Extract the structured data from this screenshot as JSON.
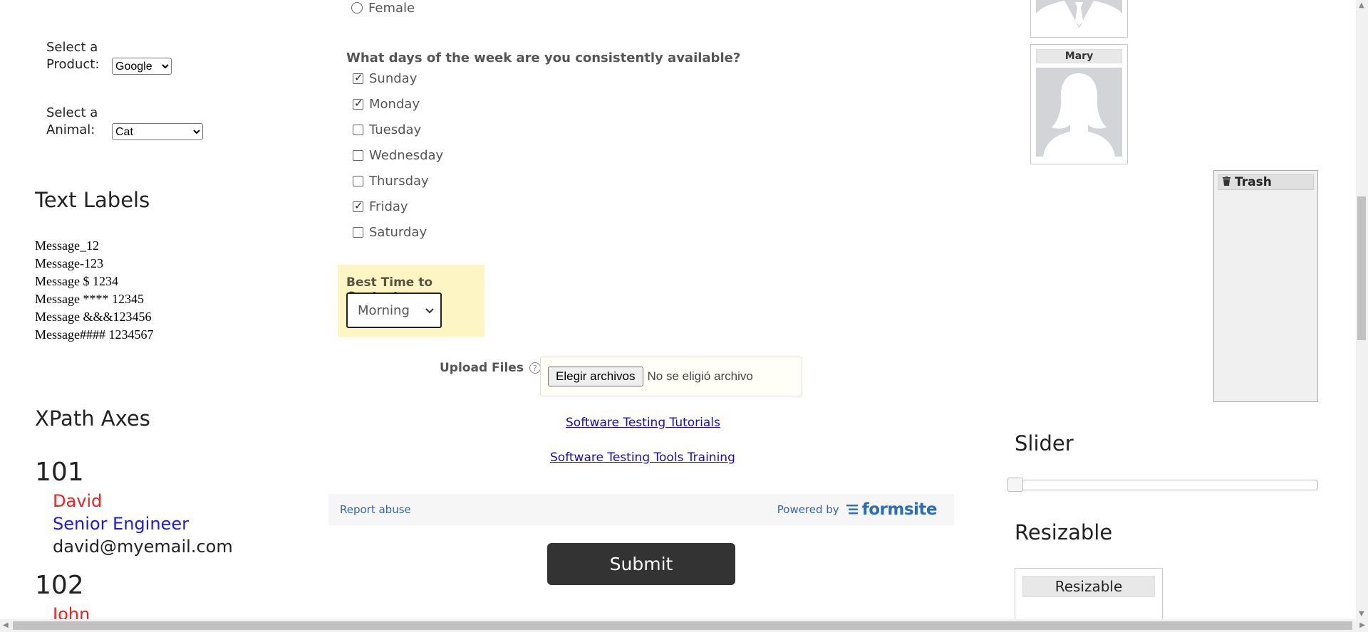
{
  "left": {
    "product": {
      "label": "Select a Product:",
      "value": "Google"
    },
    "animal": {
      "label": "Select a Animal:",
      "value": "Cat"
    },
    "text_labels": {
      "heading": "Text Labels",
      "messages": [
        "Message_12",
        "Message-123",
        "Message $ 1234",
        "Message **** 12345",
        "Message &&&123456",
        "Message#### 1234567"
      ]
    },
    "xpath": {
      "heading": "XPath Axes",
      "employees": [
        {
          "id": "101",
          "name": "David",
          "title": "Senior Engineer",
          "email": "david@myemail.com"
        },
        {
          "id": "102",
          "name": "John"
        }
      ]
    }
  },
  "form": {
    "gender_partial": "Female",
    "days_question": "What days of the week are you consistently available?",
    "days": [
      {
        "label": "Sunday",
        "checked": true
      },
      {
        "label": "Monday",
        "checked": true
      },
      {
        "label": "Tuesday",
        "checked": false
      },
      {
        "label": "Wednesday",
        "checked": false
      },
      {
        "label": "Thursday",
        "checked": false
      },
      {
        "label": "Friday",
        "checked": true
      },
      {
        "label": "Saturday",
        "checked": false
      }
    ],
    "best_time": {
      "label": "Best Time to Contact",
      "value": "Morning"
    },
    "upload": {
      "label": "Upload Files",
      "button": "Elegir archivos",
      "status": "No se eligió archivo"
    },
    "links": [
      "Software Testing Tutorials",
      "Software Testing Tools Training"
    ],
    "footer": {
      "report": "Report abuse",
      "powered": "Powered by",
      "brand": "formsite"
    },
    "submit": "Submit"
  },
  "right": {
    "cards": [
      {
        "name": ""
      },
      {
        "name": "Mary"
      }
    ],
    "trash": {
      "label": "Trash"
    },
    "slider": {
      "heading": "Slider",
      "value": 0
    },
    "resizable": {
      "heading": "Resizable",
      "box_label": "Resizable"
    }
  },
  "colors": {
    "red_name": "#ee2222",
    "blue_title": "#1a1aee",
    "highlight": "#fdf6c4"
  }
}
